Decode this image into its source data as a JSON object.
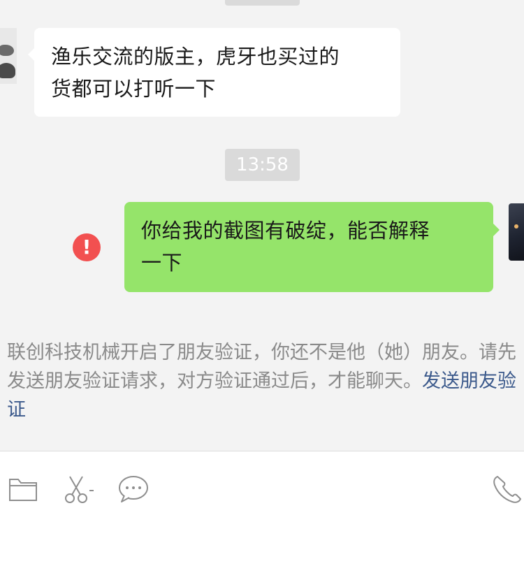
{
  "messages": {
    "incoming_text_line1": "渔乐交流的版主，虎牙也买过的",
    "incoming_text_line2": "货都可以打听一下",
    "timestamp": "13:58",
    "outgoing_text_line1": "你给我的截图有破绽，能否解释",
    "outgoing_text_line2": "一下",
    "error_mark": "!"
  },
  "system_notice": {
    "text": "联创科技机械开启了朋友验证，你还不是他（她）朋友。请先发送朋友验证请求，对方验证通过后，才能聊天。",
    "link": "发送朋友验证"
  },
  "toolbar": {
    "icons": [
      "folder-icon",
      "scissors-icon",
      "chat-bubble-icon",
      "phone-icon"
    ]
  },
  "colors": {
    "outgoing_bubble": "#95e46a",
    "incoming_bubble": "#ffffff",
    "chat_background": "#f3f3f3",
    "error": "#f25050",
    "link": "#3c5a8c"
  }
}
